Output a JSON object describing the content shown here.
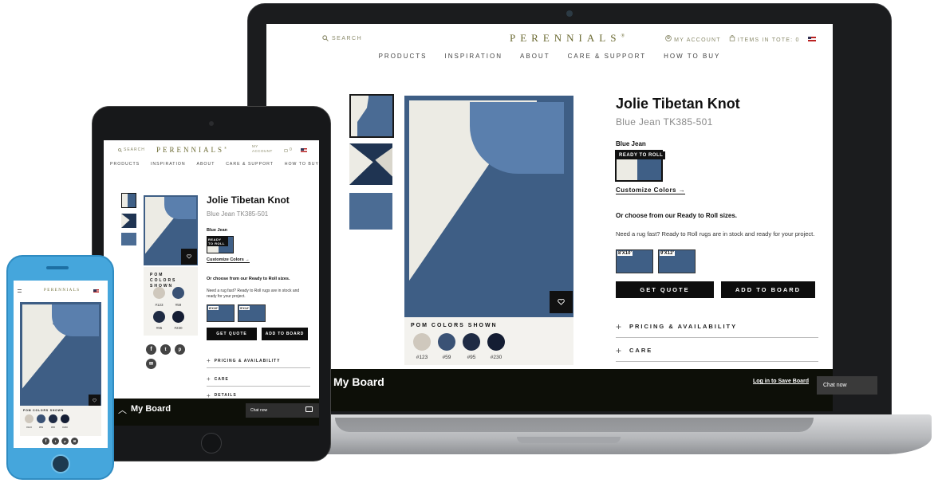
{
  "site": {
    "logo": "PERENNIALS",
    "logo_mark": "®",
    "search": "SEARCH",
    "my_account": "MY ACCOUNT",
    "my_account_short": "MY\nACCOUNT",
    "tote": "ITEMS IN TOTE: 0",
    "tote_short": "0",
    "nav": [
      "PRODUCTS",
      "INSPIRATION",
      "ABOUT",
      "CARE & SUPPORT",
      "HOW TO BUY"
    ]
  },
  "product": {
    "title": "Jolie Tibetan Knot",
    "subtitle": "Blue Jean TK385-501",
    "color_name": "Blue Jean",
    "badge": "READY TO ROLL",
    "customize": "Customize Colors",
    "or_choose": "Or choose from our Ready to Roll sizes.",
    "need_rug": "Need a rug fast? Ready to Roll rugs are in stock and ready for your project.",
    "sizes": [
      "8'X10'",
      "9'X12'"
    ],
    "get_quote": "GET QUOTE",
    "add_to_board": "ADD TO BOARD",
    "accordions": [
      "PRICING & AVAILABILITY",
      "CARE",
      "DETAILS"
    ]
  },
  "poms": {
    "title": "POM COLORS SHOWN",
    "items": [
      {
        "label": "#123",
        "color": "#cfc8bd"
      },
      {
        "label": "#59",
        "color": "#3a5275"
      },
      {
        "label": "#95",
        "color": "#1f2b44"
      },
      {
        "label": "#230",
        "color": "#141d33"
      }
    ]
  },
  "board": {
    "title": "My Board",
    "login": "Log in to Save Board",
    "chat": "Chat now"
  },
  "colors": {
    "rug_blue": "#3f5f86",
    "rug_cream": "#ecebe4",
    "brand_olive": "#6b6a32",
    "board_bg": "#0d0f08"
  }
}
